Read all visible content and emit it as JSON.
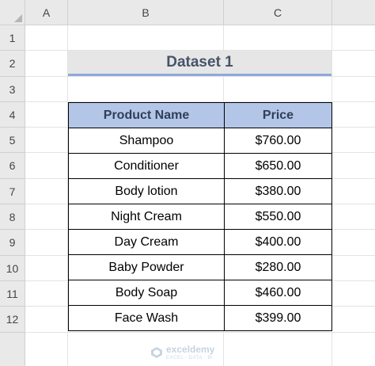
{
  "columns": [
    "A",
    "B",
    "C"
  ],
  "rows": [
    "1",
    "2",
    "3",
    "4",
    "5",
    "6",
    "7",
    "8",
    "9",
    "10",
    "11",
    "12"
  ],
  "title": "Dataset 1",
  "table": {
    "headers": [
      "Product Name",
      "Price"
    ],
    "rows": [
      [
        "Shampoo",
        "$760.00"
      ],
      [
        "Conditioner",
        "$650.00"
      ],
      [
        "Body lotion",
        "$380.00"
      ],
      [
        "Night Cream",
        "$550.00"
      ],
      [
        "Day Cream",
        "$400.00"
      ],
      [
        "Baby Powder",
        "$280.00"
      ],
      [
        "Body Soap",
        "$460.00"
      ],
      [
        "Face Wash",
        "$399.00"
      ]
    ]
  },
  "watermark": {
    "brand": "exceldemy",
    "tagline": "EXCEL · DATA · BI",
    "icon": "exceldemy-logo-icon"
  },
  "colors": {
    "title_bg": "#e7e6e6",
    "title_underline": "#8ea9db",
    "header_bg": "#b4c6e7"
  }
}
